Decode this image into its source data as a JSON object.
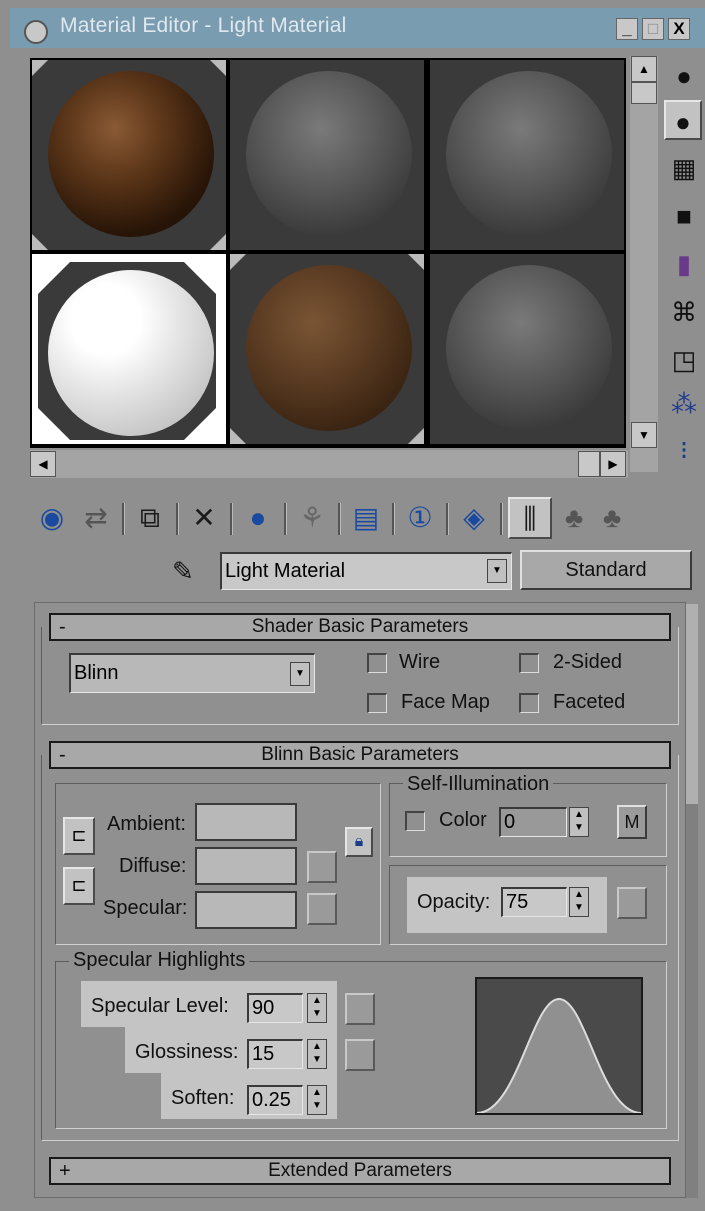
{
  "window": {
    "title": "Material Editor - Light Material",
    "buttons": [
      "_",
      "□",
      "X"
    ]
  },
  "toolbar_icons": [
    "get-material-icon",
    "put-to-scene-icon",
    "assign-to-selection-icon",
    "reset-icon",
    "make-copy-icon",
    "make-unique-icon",
    "put-to-library-icon",
    "material-effects-channel-icon",
    "show-map-in-viewport-icon",
    "show-end-result-icon",
    "go-to-parent-icon",
    "go-forward-to-sibling-icon"
  ],
  "side_icons": [
    "sample-type-icon",
    "backlight-icon",
    "background-icon",
    "uv-tiling-icon",
    "video-color-check-icon",
    "make-preview-icon",
    "options-icon",
    "select-by-material-icon",
    "material-map-navigator-icon"
  ],
  "material": {
    "name": "Light Material",
    "type_button": "Standard"
  },
  "shader_rollout": {
    "sign": "-",
    "title": "Shader Basic Parameters",
    "shader": "Blinn",
    "wire": "Wire",
    "two_sided": "2-Sided",
    "face_map": "Face Map",
    "faceted": "Faceted"
  },
  "blinn_rollout": {
    "sign": "-",
    "title": "Blinn Basic Parameters",
    "ambient": "Ambient:",
    "diffuse": "Diffuse:",
    "specular": "Specular:",
    "self_illum_title": "Self-Illumination",
    "color_label": "Color",
    "color_value": "0",
    "m_button": "M",
    "opacity_label": "Opacity:",
    "opacity_value": "75",
    "spec_title": "Specular Highlights",
    "spec_level_label": "Specular Level:",
    "spec_level_value": "90",
    "gloss_label": "Glossiness:",
    "gloss_value": "15",
    "soften_label": "Soften:",
    "soften_value": "0.25"
  },
  "extended_rollout": {
    "sign": "+",
    "title": "Extended Parameters"
  },
  "colors": {
    "title_bar": "#7a9cb0",
    "panel": "#909090",
    "highlight": "#c4c4c4"
  }
}
